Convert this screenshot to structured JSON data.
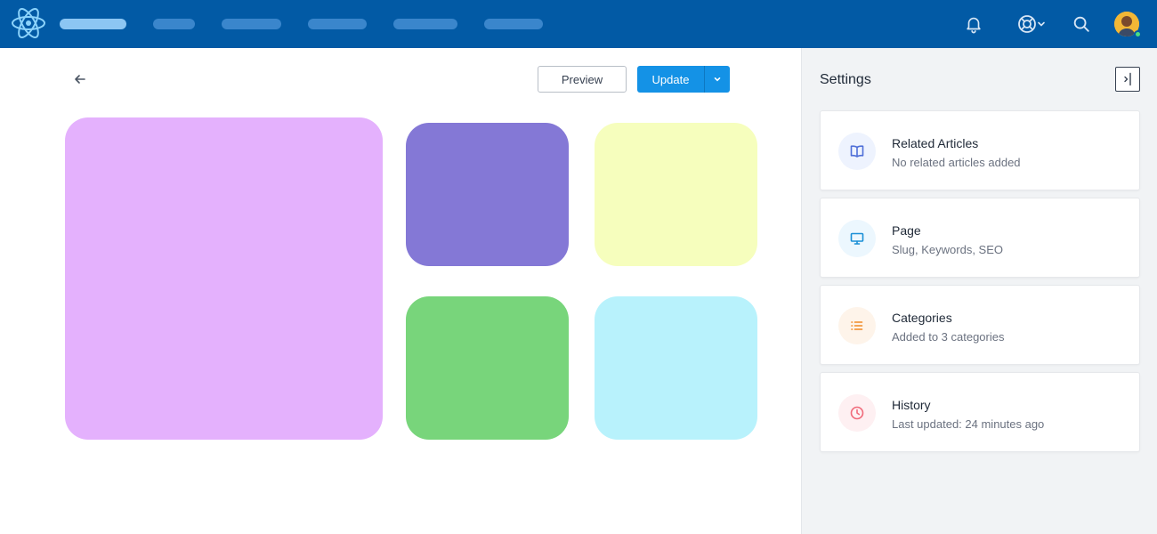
{
  "header": {
    "nav_items": [
      "",
      "",
      "",
      "",
      "",
      ""
    ],
    "icons": [
      "react-logo-icon",
      "bell-icon",
      "lifebuoy-icon",
      "chevron-down-icon",
      "search-icon",
      "avatar"
    ],
    "colors": {
      "bar": "#025aa5",
      "pill": "#3a86cc",
      "pill_active": "#8cc6f3"
    }
  },
  "toolbar": {
    "back_icon": "arrow-left-icon",
    "preview_label": "Preview",
    "update_label": "Update",
    "update_menu_icon": "chevron-down-icon"
  },
  "tiles": [
    {
      "name": "tile-large",
      "color": "#e4b1fd"
    },
    {
      "name": "tile-purple",
      "color": "#8478d6"
    },
    {
      "name": "tile-yellow",
      "color": "#f6febd"
    },
    {
      "name": "tile-green",
      "color": "#78d57b"
    },
    {
      "name": "tile-cyan",
      "color": "#b8f2fc"
    }
  ],
  "settings": {
    "title": "Settings",
    "collapse_icon": "panel-collapse-icon",
    "cards": [
      {
        "title": "Related Articles",
        "subtitle": "No related articles added",
        "icon": "book-icon",
        "color": "#4f6fd8"
      },
      {
        "title": "Page",
        "subtitle": "Slug, Keywords, SEO",
        "icon": "monitor-icon",
        "color": "#1a8fd6"
      },
      {
        "title": "Categories",
        "subtitle": "Added to 3 categories",
        "icon": "list-icon",
        "color": "#f08a24"
      },
      {
        "title": "History",
        "subtitle": "Last updated: 24 minutes ago",
        "icon": "clock-icon",
        "color": "#f06a7a"
      }
    ]
  }
}
